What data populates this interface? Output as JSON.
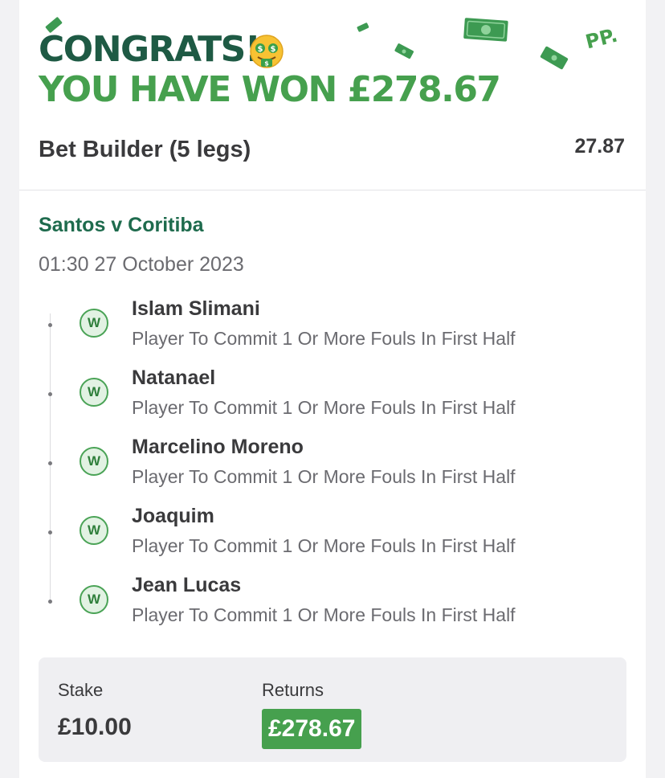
{
  "header": {
    "congrats": "CONGRATS!",
    "won": "YOU HAVE WON £278.67",
    "brand_mark": "PP.",
    "emoji_icon": "money-mouth-face-icon",
    "colors": {
      "dark_green": "#1e5a44",
      "bright_green": "#46a04e"
    }
  },
  "bet": {
    "title": "Bet Builder (5 legs)",
    "odds": "27.87"
  },
  "event": {
    "match": "Santos v Coritiba",
    "datetime": "01:30 27 October 2023"
  },
  "legs": [
    {
      "status": "W",
      "selection": "Islam Slimani",
      "market": "Player To Commit 1 Or More Fouls In First Half"
    },
    {
      "status": "W",
      "selection": "Natanael",
      "market": "Player To Commit 1 Or More Fouls In First Half"
    },
    {
      "status": "W",
      "selection": "Marcelino Moreno",
      "market": "Player To Commit 1 Or More Fouls In First Half"
    },
    {
      "status": "W",
      "selection": "Joaquim",
      "market": "Player To Commit 1 Or More Fouls In First Half"
    },
    {
      "status": "W",
      "selection": "Jean Lucas",
      "market": "Player To Commit 1 Or More Fouls In First Half"
    }
  ],
  "summary": {
    "stake_label": "Stake",
    "stake_value": "£10.00",
    "returns_label": "Returns",
    "returns_value": "£278.67"
  }
}
